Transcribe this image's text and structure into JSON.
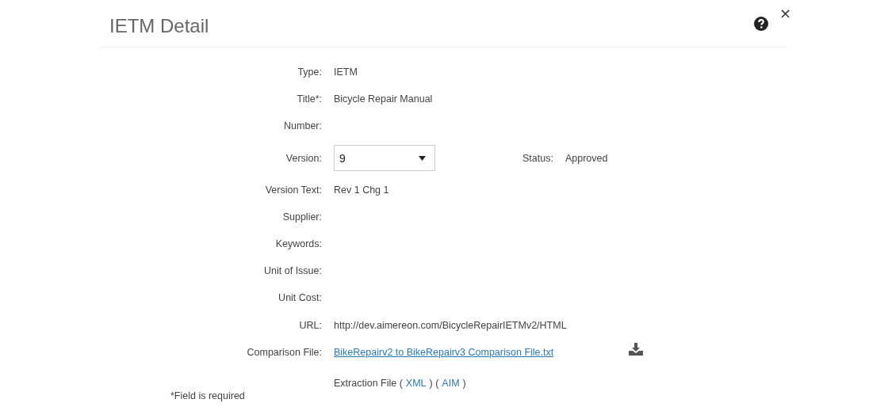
{
  "dialog": {
    "title": "IETM Detail",
    "close_label": "×"
  },
  "fields": [
    {
      "label": "Type:",
      "kind": "text",
      "value": "IETM"
    },
    {
      "label": "Title*:",
      "kind": "text",
      "value": "Bicycle Repair Manual"
    },
    {
      "label": "Number:",
      "kind": "text"
    },
    {
      "label": "Version:",
      "kind": "select",
      "value": "9",
      "status_label": "Status:",
      "status_value": "Approved"
    },
    {
      "label": "Version Text:",
      "kind": "text",
      "value": "Rev 1 Chg 1"
    },
    {
      "label": "Supplier:",
      "kind": "text"
    },
    {
      "label": "Keywords:",
      "kind": "text"
    },
    {
      "label": "Unit of Issue:",
      "kind": "text"
    },
    {
      "label": "Unit Cost:",
      "kind": "text"
    },
    {
      "label": "URL:",
      "kind": "text",
      "value": "http://dev.aimereon.com/BicycleRepairIETMv2/HTML"
    },
    {
      "label": "Comparison File:",
      "kind": "file",
      "value": "BikeRepairv2 to BikeRepairv3 Comparison File.txt"
    }
  ],
  "extraction": [
    {
      "text": "Extraction File (",
      "link": false
    },
    {
      "text": "XML",
      "link": true
    },
    {
      "text": ") (",
      "link": false
    },
    {
      "text": "AIM",
      "link": true
    },
    {
      "text": ")",
      "link": false
    }
  ],
  "footnote": "*Field is required"
}
